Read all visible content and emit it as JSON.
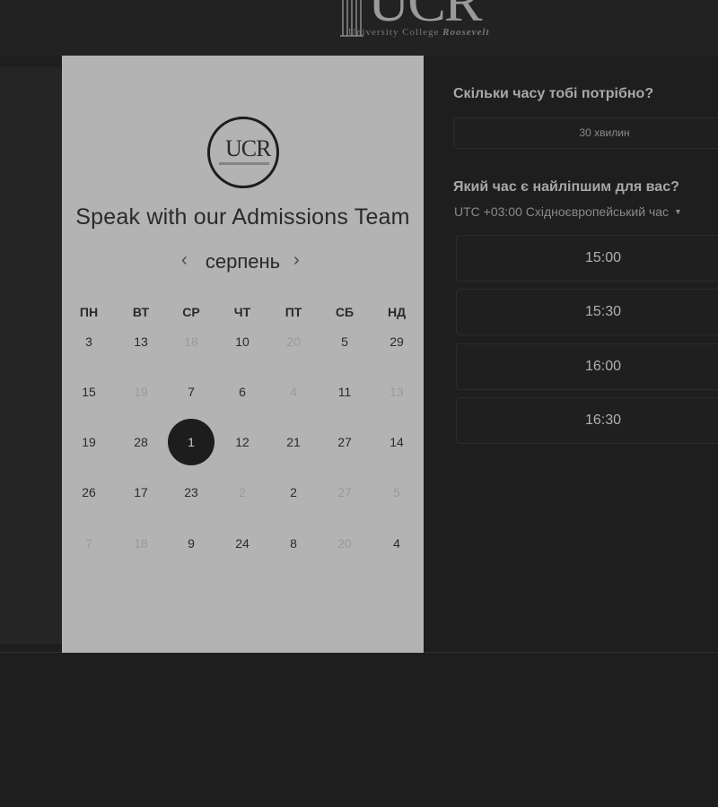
{
  "header": {
    "logo_big": "UCR",
    "logo_sub": "University College",
    "logo_sub_bold": "Roosevelt"
  },
  "card": {
    "emblem_text": "UCR",
    "title": "Speak with our Admissions Team",
    "month": "серпень",
    "weekdays": [
      "ПН",
      "ВТ",
      "СР",
      "ЧТ",
      "ПТ",
      "СБ",
      "НД"
    ],
    "rows": [
      [
        {
          "d": "3",
          "s": "n"
        },
        {
          "d": "13",
          "s": "n"
        },
        {
          "d": "18",
          "s": "dim"
        },
        {
          "d": "10",
          "s": "n"
        },
        {
          "d": "20",
          "s": "dim"
        },
        {
          "d": "5",
          "s": "n"
        },
        {
          "d": "29",
          "s": "n"
        }
      ],
      [
        {
          "d": "15",
          "s": "n"
        },
        {
          "d": "19",
          "s": "dim"
        },
        {
          "d": "7",
          "s": "n"
        },
        {
          "d": "6",
          "s": "n"
        },
        {
          "d": "4",
          "s": "dim"
        },
        {
          "d": "11",
          "s": "n"
        },
        {
          "d": "13",
          "s": "dim"
        }
      ],
      [
        {
          "d": "19",
          "s": "n"
        },
        {
          "d": "28",
          "s": "n"
        },
        {
          "d": "1",
          "s": "sel"
        },
        {
          "d": "12",
          "s": "n"
        },
        {
          "d": "21",
          "s": "n"
        },
        {
          "d": "27",
          "s": "n"
        },
        {
          "d": "14",
          "s": "n"
        }
      ],
      [
        {
          "d": "26",
          "s": "n"
        },
        {
          "d": "17",
          "s": "n"
        },
        {
          "d": "23",
          "s": "n"
        },
        {
          "d": "2",
          "s": "dim"
        },
        {
          "d": "2",
          "s": "n"
        },
        {
          "d": "27",
          "s": "dim"
        },
        {
          "d": "5",
          "s": "dim"
        }
      ],
      [
        {
          "d": "7",
          "s": "dim"
        },
        {
          "d": "18",
          "s": "dim"
        },
        {
          "d": "9",
          "s": "n"
        },
        {
          "d": "24",
          "s": "n"
        },
        {
          "d": "8",
          "s": "n"
        },
        {
          "d": "20",
          "s": "dim"
        },
        {
          "d": "4",
          "s": "n"
        }
      ]
    ]
  },
  "panel": {
    "duration_question": "Скільки часу тобі потрібно?",
    "duration_value": "30 хвилин",
    "time_question": "Який час є найліпшим для вас?",
    "timezone": "UTC +03:00 Східноєвропейський час",
    "slots": [
      "15:00",
      "15:30",
      "16:00",
      "16:30"
    ]
  },
  "icons": {
    "prev": "chevron-left-icon",
    "next": "chevron-right-icon",
    "caret": "caret-down-icon"
  }
}
